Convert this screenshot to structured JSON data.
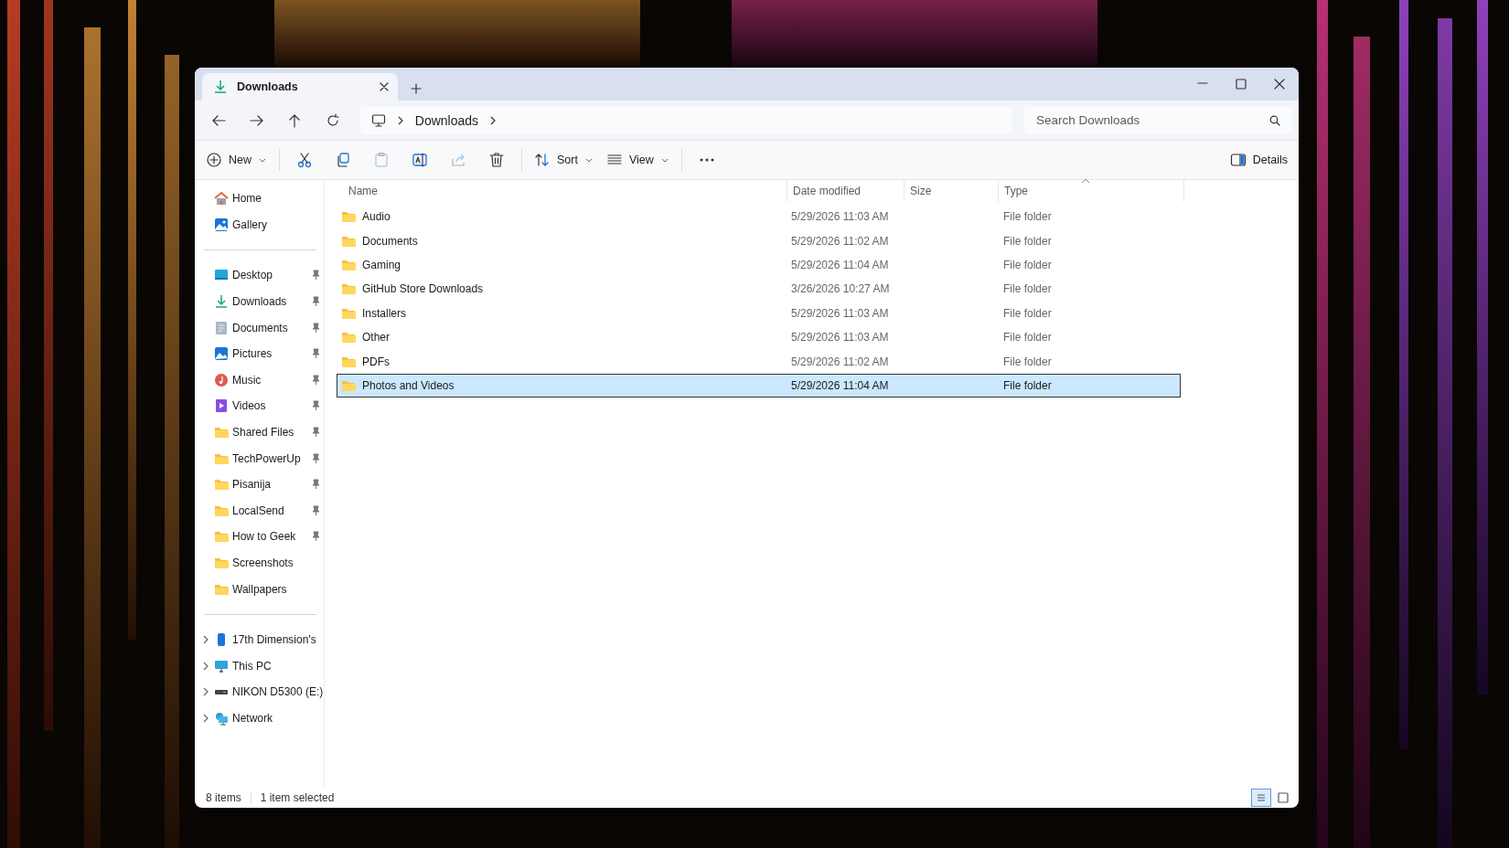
{
  "tabs": [
    {
      "label": "Downloads",
      "kind": "downloads",
      "selected": true
    }
  ],
  "address": {
    "crumbs": [
      "Downloads"
    ]
  },
  "search": {
    "placeholder": "Search Downloads"
  },
  "toolbar": [
    {
      "kind": "new",
      "label": "New",
      "disabled": false
    },
    {
      "kind": "cut",
      "disabled": false
    },
    {
      "kind": "copy",
      "disabled": false
    },
    {
      "kind": "paste",
      "disabled": true
    },
    {
      "kind": "rename",
      "disabled": false
    },
    {
      "kind": "share",
      "disabled": true
    },
    {
      "kind": "delete",
      "disabled": false
    },
    {
      "kind": "sort",
      "label": "Sort",
      "disabled": false
    },
    {
      "kind": "view",
      "label": "View",
      "disabled": false
    },
    {
      "kind": "more",
      "disabled": false
    },
    {
      "kind": "details",
      "label": "Details",
      "disabled": false
    }
  ],
  "sidebar": {
    "sections": [
      [
        {
          "label": "Home",
          "kind": "home"
        },
        {
          "label": "Gallery",
          "kind": "gallery"
        }
      ],
      [
        {
          "label": "Desktop",
          "kind": "desktop",
          "pinned": true
        },
        {
          "label": "Downloads",
          "kind": "downloads",
          "pinned": true
        },
        {
          "label": "Documents",
          "kind": "documents",
          "pinned": true
        },
        {
          "label": "Pictures",
          "kind": "pictures",
          "pinned": true
        },
        {
          "label": "Music",
          "kind": "music",
          "pinned": true
        },
        {
          "label": "Videos",
          "kind": "videos",
          "pinned": true
        },
        {
          "label": "Shared Files",
          "kind": "folder",
          "pinned": true
        },
        {
          "label": "TechPowerUp",
          "kind": "folder",
          "pinned": true
        },
        {
          "label": "Pisanija",
          "kind": "folder",
          "pinned": true
        },
        {
          "label": "LocalSend",
          "kind": "folder",
          "pinned": true
        },
        {
          "label": "How to Geek",
          "kind": "folder",
          "pinned": true
        },
        {
          "label": "Screenshots",
          "kind": "folder",
          "pinned": false
        },
        {
          "label": "Wallpapers",
          "kind": "folder",
          "pinned": false
        }
      ],
      [
        {
          "label": "17th Dimension's",
          "kind": "phone",
          "expanded": false
        },
        {
          "label": "This PC",
          "kind": "pc",
          "expanded": false
        },
        {
          "label": "NIKON D5300 (E:)",
          "kind": "drive",
          "expanded": false
        },
        {
          "label": "Network",
          "kind": "network",
          "expanded": false
        }
      ]
    ]
  },
  "table": {
    "columns": [
      {
        "label": "Name",
        "sorted": false
      },
      {
        "label": "Date modified",
        "sorted": false
      },
      {
        "label": "Size",
        "sorted": false
      },
      {
        "label": "Type",
        "sorted": true
      }
    ],
    "rows": [
      {
        "name": "Audio",
        "date": "5/29/2026 11:03 AM",
        "type": "File folder",
        "selected": false
      },
      {
        "name": "Documents",
        "date": "5/29/2026 11:02 AM",
        "type": "File folder",
        "selected": false
      },
      {
        "name": "Gaming",
        "date": "5/29/2026 11:04 AM",
        "type": "File folder",
        "selected": false
      },
      {
        "name": "GitHub Store Downloads",
        "date": "3/26/2026 10:27 AM",
        "type": "File folder",
        "selected": false
      },
      {
        "name": "Installers",
        "date": "5/29/2026 11:03 AM",
        "type": "File folder",
        "selected": false
      },
      {
        "name": "Other",
        "date": "5/29/2026 11:03 AM",
        "type": "File folder",
        "selected": false
      },
      {
        "name": "PDFs",
        "date": "5/29/2026 11:02 AM",
        "type": "File folder",
        "selected": false
      },
      {
        "name": "Photos and Videos",
        "date": "5/29/2026 11:04 AM",
        "type": "File folder",
        "selected": true
      }
    ]
  },
  "status_bar": {
    "count": "8 items",
    "selection": "1 item selected",
    "views": [
      {
        "kind": "details",
        "selected": true
      },
      {
        "kind": "tiles",
        "selected": false
      }
    ]
  }
}
